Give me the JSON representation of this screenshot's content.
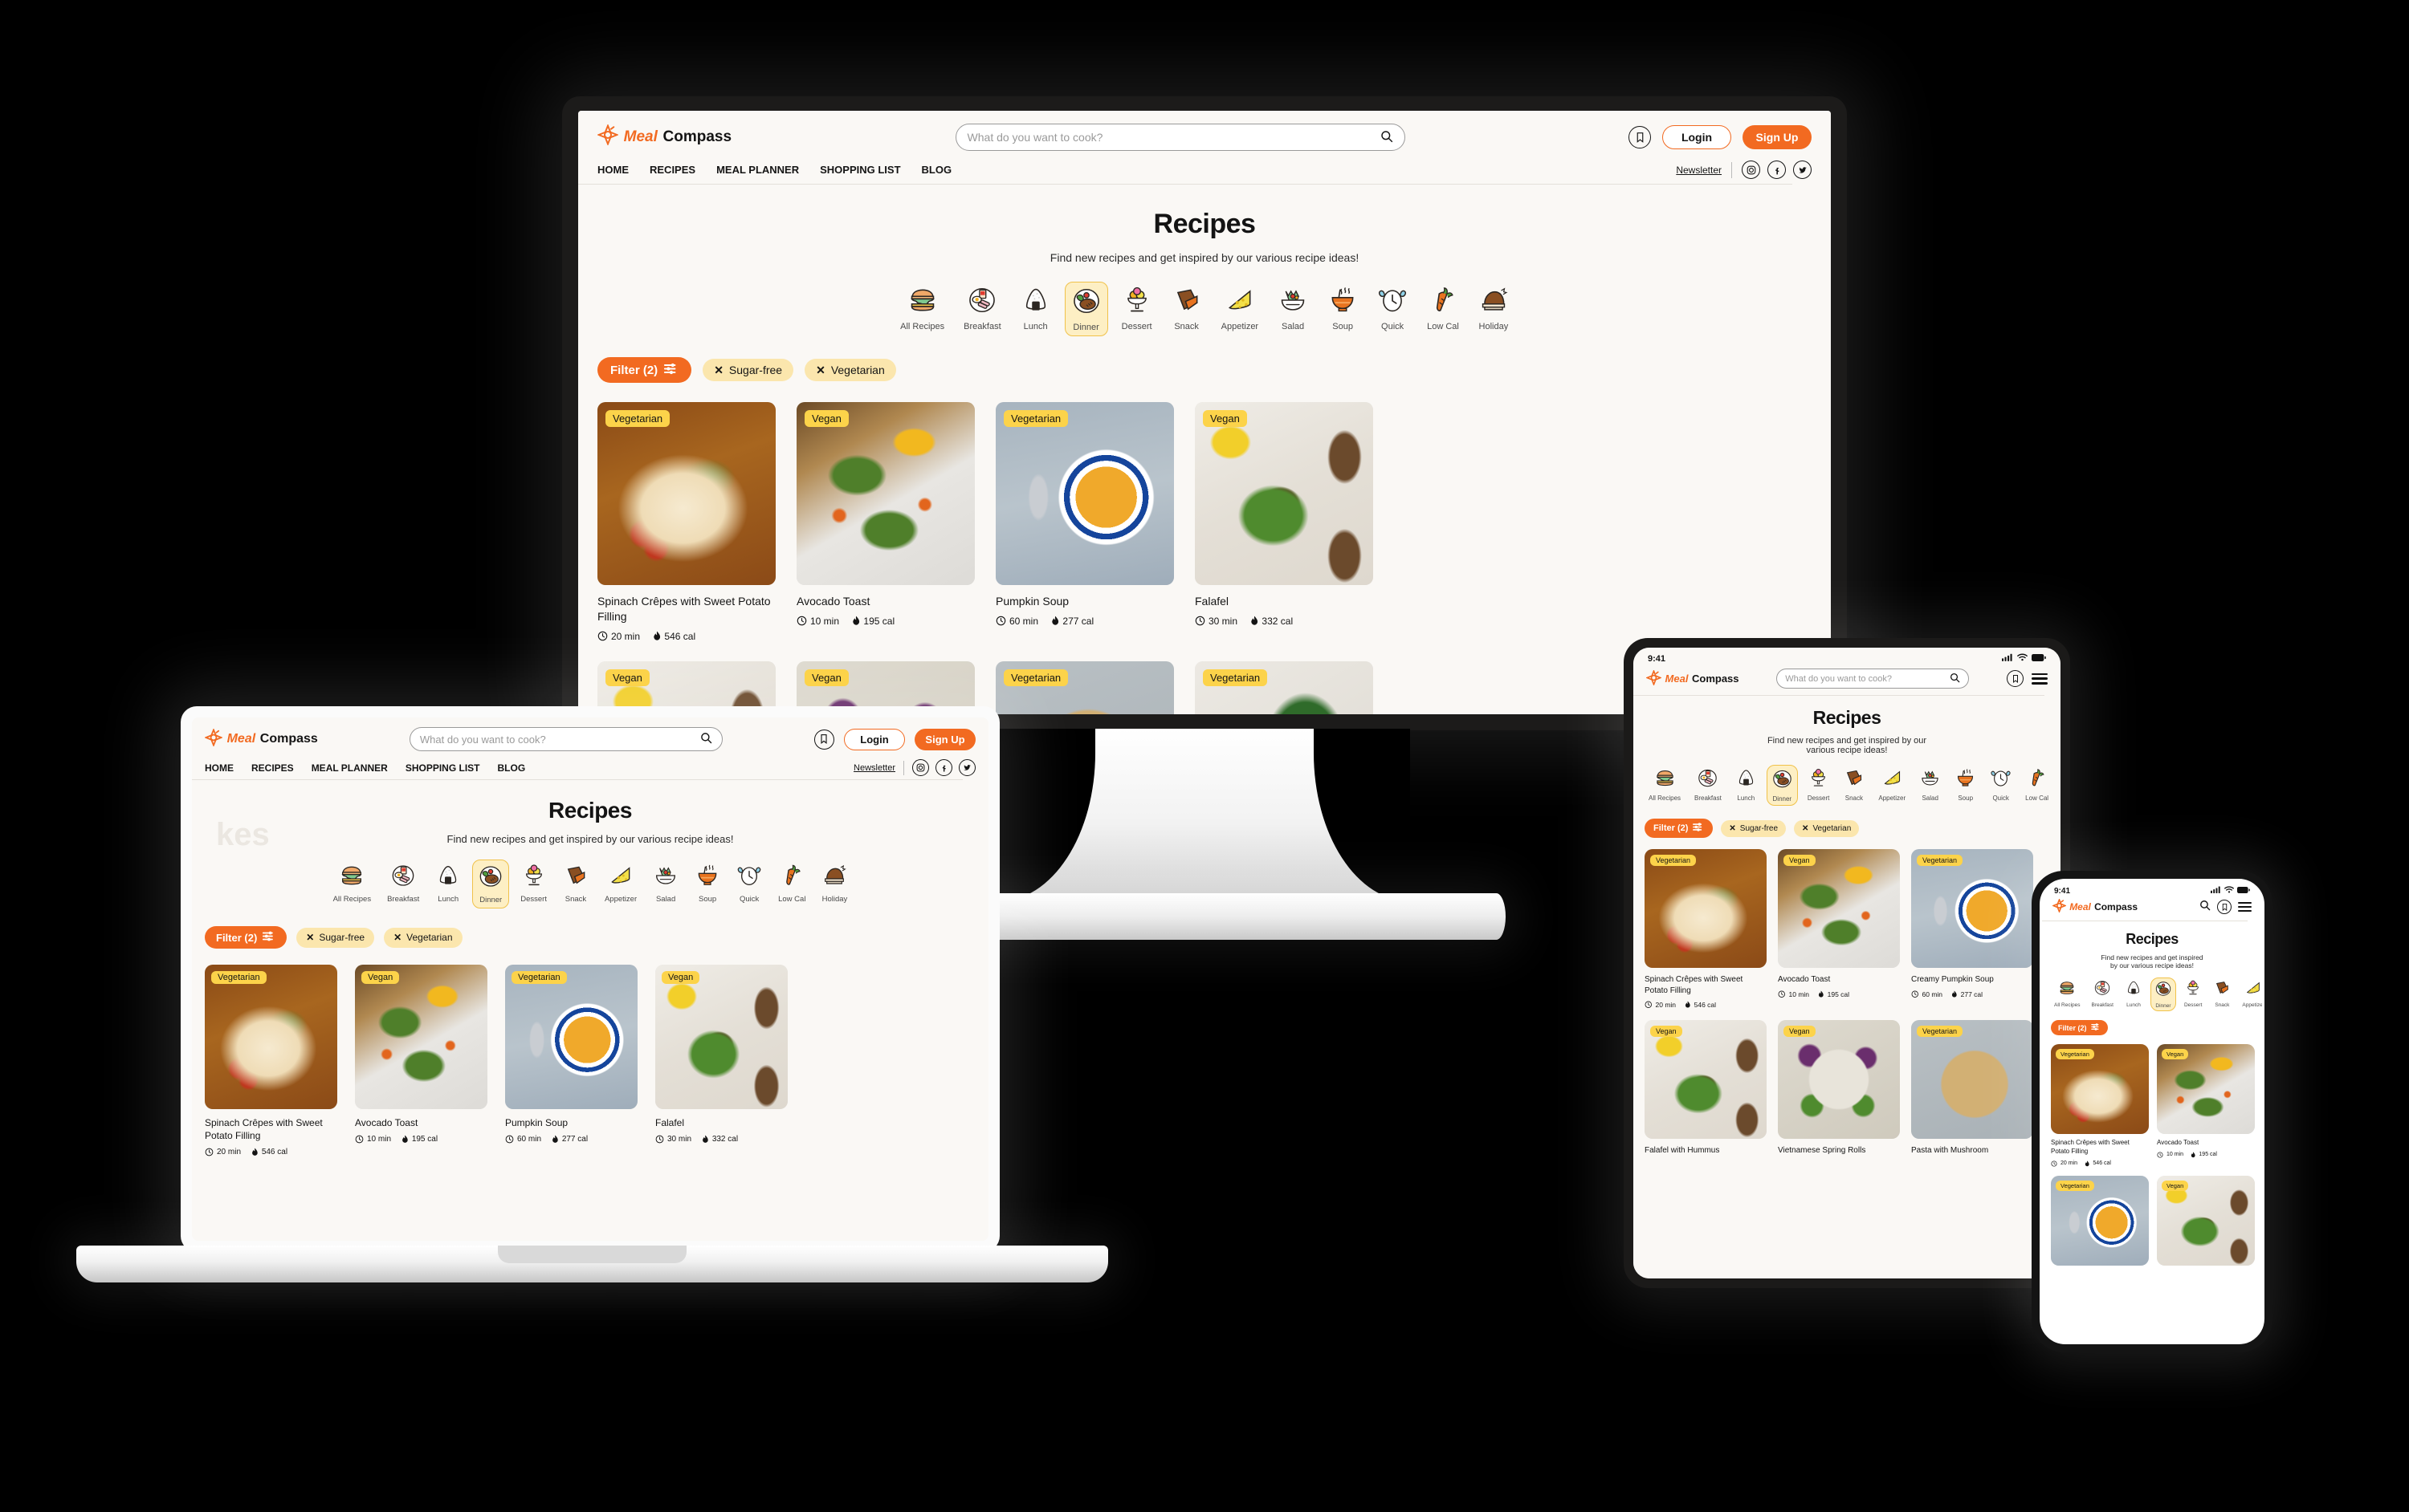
{
  "brand": {
    "meal": "Meal",
    "compass": "Compass",
    "logo_icon": "compass-star-icon",
    "accent": "#f26a21",
    "badge_color": "#fcd34a",
    "chip_color": "#fbe6ad"
  },
  "header": {
    "search_placeholder": "What do you want to cook?",
    "search_icon": "search-icon",
    "bookmark_icon": "bookmark-icon",
    "login_label": "Login",
    "signup_label": "Sign Up",
    "nav": [
      "HOME",
      "RECIPES",
      "MEAL PLANNER",
      "SHOPPING LIST",
      "BLOG"
    ],
    "newsletter_label": "Newsletter",
    "socials": [
      "instagram-icon",
      "facebook-icon",
      "twitter-icon"
    ],
    "menu_icon": "hamburger-menu-icon"
  },
  "page": {
    "title": "Recipes",
    "subtitle": "Find new recipes and get inspired by our various recipe ideas!",
    "subtitle_line1": "Find new recipes and get inspired by our",
    "subtitle_line2": "various recipe ideas!",
    "subtitle_phone_l1": "Find new recipes and get inspired",
    "subtitle_phone_l2": "by our various recipe ideas!",
    "ghost_text": "kes"
  },
  "categories": [
    {
      "label": "All Recipes",
      "icon": "burger-icon",
      "active": false
    },
    {
      "label": "Breakfast",
      "icon": "breakfast-plate-icon",
      "active": false
    },
    {
      "label": "Lunch",
      "icon": "onigiri-icon",
      "active": false
    },
    {
      "label": "Dinner",
      "icon": "dinner-plate-icon",
      "active": true
    },
    {
      "label": "Dessert",
      "icon": "ice-cream-icon",
      "active": false
    },
    {
      "label": "Snack",
      "icon": "chocolate-bar-icon",
      "active": false
    },
    {
      "label": "Appetizer",
      "icon": "cheese-wedge-icon",
      "active": false
    },
    {
      "label": "Salad",
      "icon": "salad-bowl-icon",
      "active": false
    },
    {
      "label": "Soup",
      "icon": "soup-bowl-icon",
      "active": false
    },
    {
      "label": "Quick",
      "icon": "alarm-clock-icon",
      "active": false
    },
    {
      "label": "Low Cal",
      "icon": "carrot-icon",
      "active": false
    },
    {
      "label": "Holiday",
      "icon": "roast-turkey-icon",
      "active": false
    }
  ],
  "filters": {
    "button_label": "Filter (2)",
    "slider_icon": "sliders-icon",
    "chips": [
      {
        "label": "Sugar-free",
        "remove_icon": "close-x-icon"
      },
      {
        "label": "Vegetarian",
        "remove_icon": "close-x-icon"
      }
    ]
  },
  "recipes": [
    {
      "name": "Spinach Crêpes with Sweet Potato Filling",
      "name_l1": "Spinach Crêpes with",
      "name_l2": "Sweet Potato Filling",
      "badge": "Vegetarian",
      "time": "20 min",
      "calories": "546 cal",
      "photo": "ph-crepes"
    },
    {
      "name": "Avocado Toast",
      "badge": "Vegan",
      "time": "10 min",
      "calories": "195 cal",
      "photo": "ph-avocado"
    },
    {
      "name": "Pumpkin Soup",
      "name_tablet": "Creamy Pumpkin Soup",
      "badge": "Vegetarian",
      "time": "60 min",
      "calories": "277 cal",
      "photo": "ph-pumpkin"
    },
    {
      "name": "Falafel",
      "name_tablet": "Falafel with Hummus",
      "badge": "Vegan",
      "time": "30 min",
      "calories": "332 cal",
      "photo": "ph-falafel"
    }
  ],
  "recipes_row2": [
    {
      "name": "Falafel with Hummus",
      "badge": "Vegan",
      "photo": "ph-falafel"
    },
    {
      "name": "Vietnamese Spring Rolls",
      "badge": "Vegan",
      "photo": "ph-spring"
    },
    {
      "name": "Pasta with Mushroom",
      "badge": "Vegetarian",
      "photo": "ph-pasta"
    },
    {
      "name": "",
      "badge": "Vegetarian",
      "photo": "ph-green"
    },
    {
      "name": "",
      "badge": "Vegetarian",
      "photo": "ph-salsa"
    }
  ],
  "status": {
    "time": "9:41",
    "cellular_icon": "cellular-bars-icon",
    "wifi_icon": "wifi-icon",
    "battery_icon": "battery-icon"
  },
  "meta": {
    "clock_icon": "clock-icon",
    "flame_icon": "flame-icon"
  }
}
